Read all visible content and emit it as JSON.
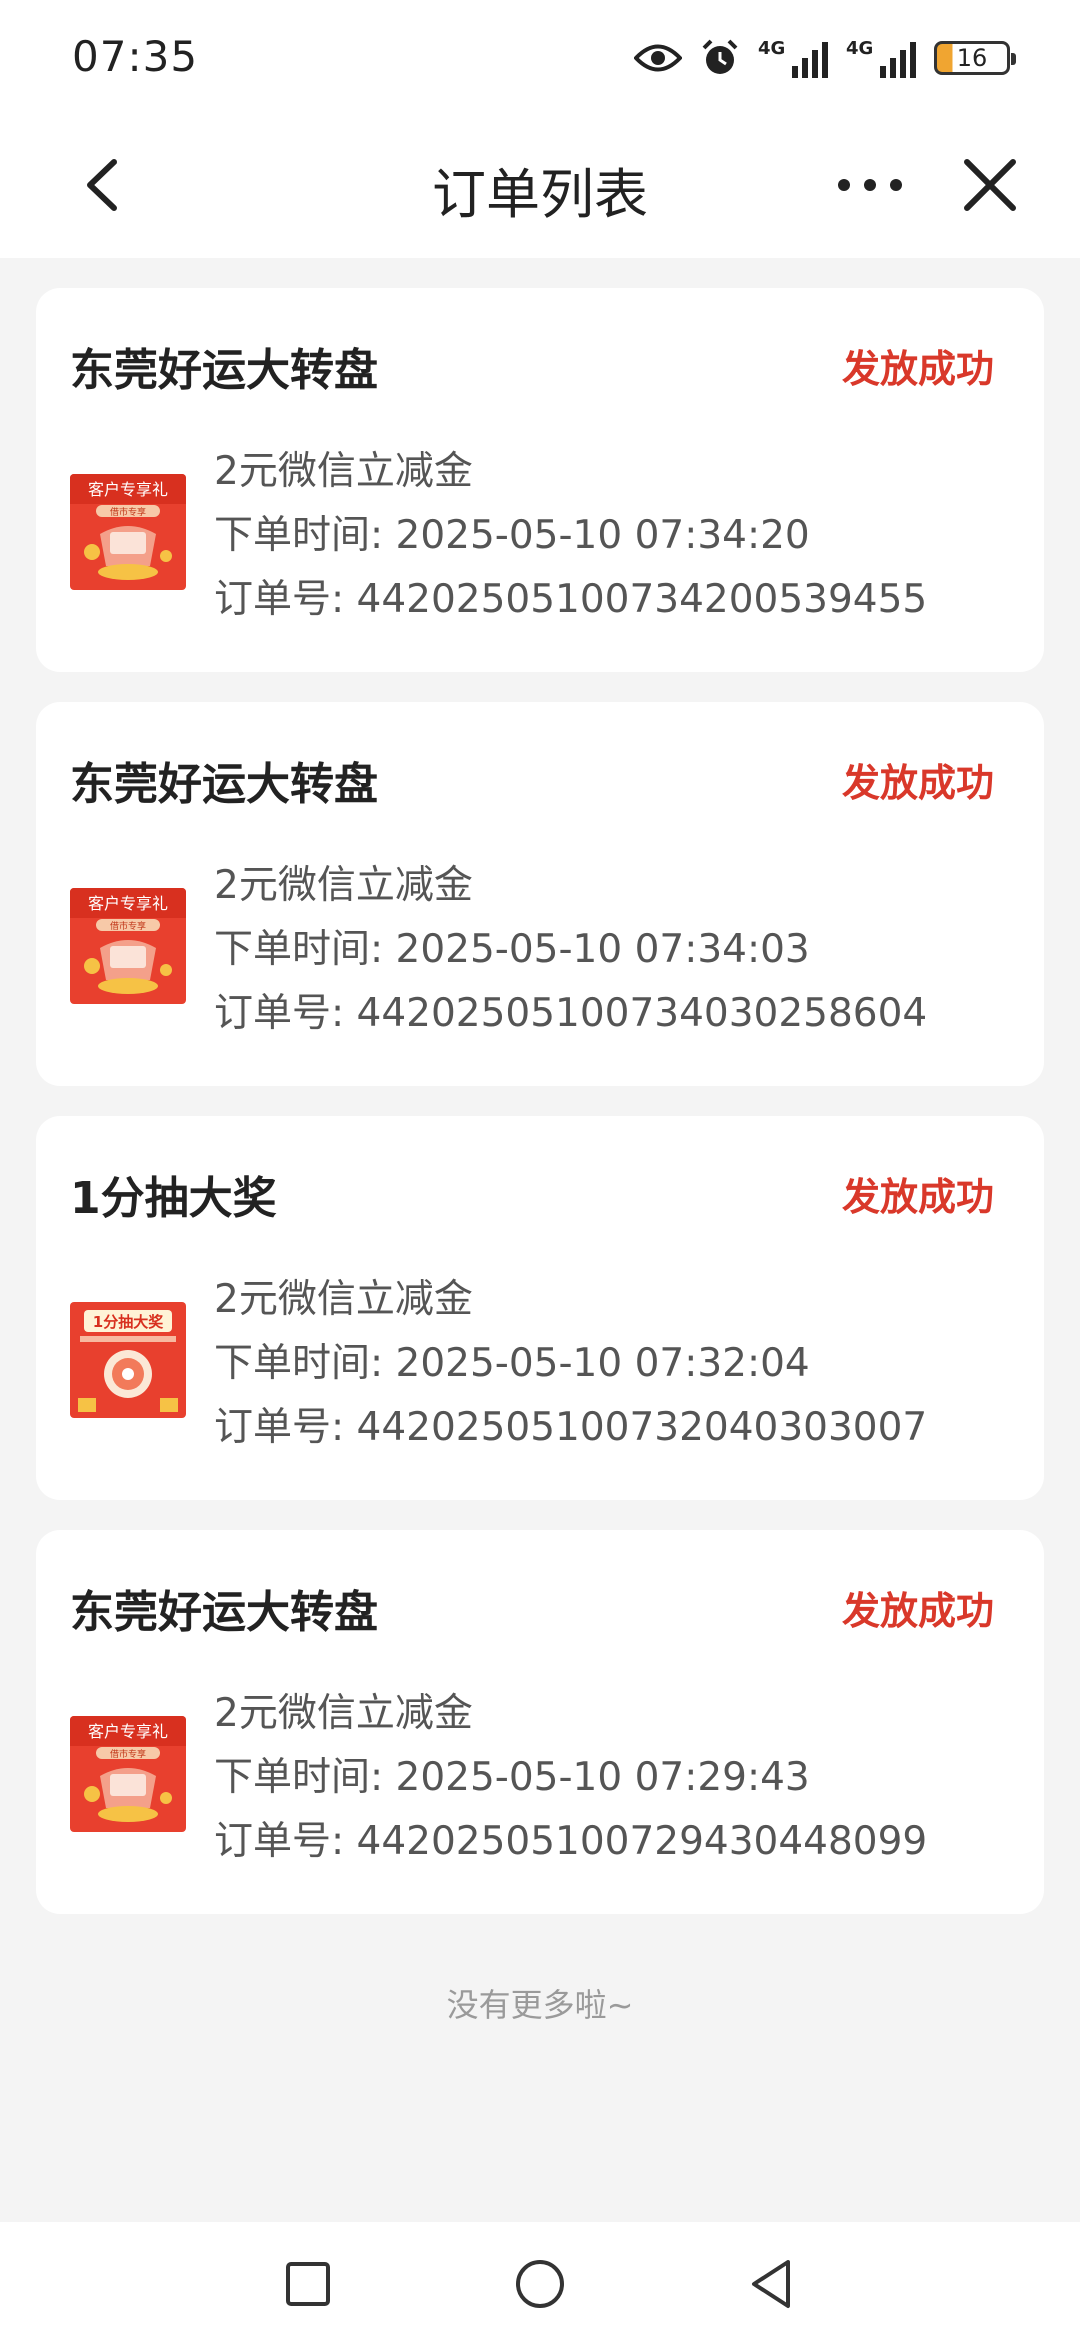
{
  "status_bar": {
    "time": "07:35",
    "network_1": "4G",
    "network_2": "4G",
    "battery_level": "16",
    "icons": [
      "eye-icon",
      "alarm-icon",
      "signal-icon",
      "signal-icon",
      "battery-icon"
    ]
  },
  "header": {
    "title": "订单列表",
    "back_icon": "chevron-left-icon",
    "more_icon": "more-dots-icon",
    "close_icon": "close-icon"
  },
  "orders": [
    {
      "title": "东莞好运大转盘",
      "status": "发放成功",
      "thumb_type": "gift",
      "thumb_label": "客户专享礼",
      "thumb_sub": "借市专享",
      "item": "2元微信立减金",
      "time": "下单时间: 2025-05-10 07:34:20",
      "order_no": "订单号: 442025051007342005​39455"
    },
    {
      "title": "东莞好运大转盘",
      "status": "发放成功",
      "thumb_type": "gift",
      "thumb_label": "客户专享礼",
      "thumb_sub": "借市专享",
      "item": "2元微信立减金",
      "time": "下单时间: 2025-05-10 07:34:03",
      "order_no": "订单号: 44202505100734030258604"
    },
    {
      "title": "1分抽大奖",
      "status": "发放成功",
      "thumb_type": "lottery",
      "thumb_label": "1分抽大奖",
      "thumb_sub": "",
      "item": "2元微信立减金",
      "time": "下单时间: 2025-05-10 07:32:04",
      "order_no": "订单号: 44202505100732040303007"
    },
    {
      "title": "东莞好运大转盘",
      "status": "发放成功",
      "thumb_type": "gift",
      "thumb_label": "客户专享礼",
      "thumb_sub": "借市专享",
      "item": "2元微信立减金",
      "time": "下单时间: 2025-05-10 07:29:43",
      "order_no": "订单号: 44202505100729430448099"
    }
  ],
  "footer": {
    "end_text": "没有更多啦~"
  },
  "system_nav": {
    "icons": [
      "recent-apps-icon",
      "home-icon",
      "back-icon"
    ]
  },
  "colors": {
    "status_success": "#d9382a",
    "thumb_red": "#e8402e",
    "background": "#f4f4f4"
  }
}
